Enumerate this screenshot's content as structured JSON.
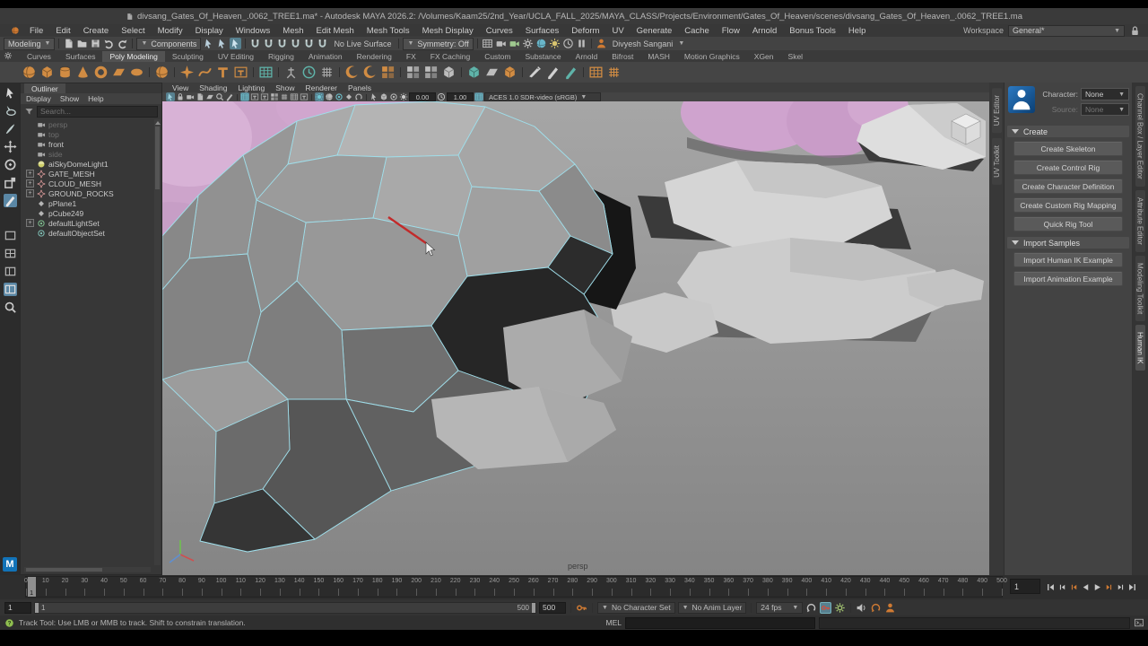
{
  "window": {
    "title": "divsang_Gates_Of_Heaven_.0062_TREE1.ma* - Autodesk MAYA 2026.2: /Volumes/Kaam25/2nd_Year/UCLA_FALL_2025/MAYA_CLASS/Projects/Environment/Gates_Of_Heaven/scenes/divsang_Gates_Of_Heaven_.0062_TREE1.ma"
  },
  "menu_bar": {
    "items": [
      "File",
      "Edit",
      "Create",
      "Select",
      "Modify",
      "Display",
      "Windows",
      "Mesh",
      "Edit Mesh",
      "Mesh Tools",
      "Mesh Display",
      "Curves",
      "Surfaces",
      "Deform",
      "UV",
      "Generate",
      "Cache",
      "Flow",
      "Arnold",
      "Bonus Tools",
      "Help"
    ],
    "workspace_label": "Workspace",
    "workspace_value": "General*"
  },
  "status_line": {
    "mode": "Modeling",
    "selection_label": "Components",
    "live_surface": "No Live Surface",
    "symmetry": "Symmetry: Off",
    "user": "Divyesh Sangani",
    "file_icons": [
      {
        "name": "new-scene-icon",
        "glyph": "doc",
        "color": "#c9c9c9"
      },
      {
        "name": "open-scene-icon",
        "glyph": "folder",
        "color": "#c9c9c9"
      },
      {
        "name": "save-scene-icon",
        "glyph": "save",
        "color": "#c9c9c9"
      },
      {
        "name": "undo-icon",
        "glyph": "undo",
        "color": "#c9c9c9"
      },
      {
        "name": "redo-icon",
        "glyph": "redo",
        "color": "#c9c9c9"
      }
    ],
    "mask_icons": [
      {
        "name": "select-hierarchy-icon",
        "glyph": "cursor",
        "color": "#b9cfdb"
      },
      {
        "name": "select-object-icon",
        "glyph": "cursor",
        "color": "#b9cfdb"
      },
      {
        "name": "select-component-icon",
        "glyph": "cursor",
        "color": "#cfe4ee",
        "active": true
      }
    ],
    "snap_icons": [
      {
        "name": "snap-grid-icon",
        "glyph": "magnet",
        "color": "#b7c9c9"
      },
      {
        "name": "snap-curve-icon",
        "glyph": "magnet",
        "color": "#b7c9c9"
      },
      {
        "name": "snap-point-icon",
        "glyph": "magnet",
        "color": "#b7c9c9"
      },
      {
        "name": "snap-projected-center-icon",
        "glyph": "magnet",
        "color": "#b7c9c9"
      },
      {
        "name": "snap-view-plane-icon",
        "glyph": "magnet",
        "color": "#b7c9c9"
      },
      {
        "name": "make-live-icon",
        "glyph": "magnet",
        "color": "#b7c9c9"
      }
    ],
    "render_icons": [
      {
        "name": "render-view-icon",
        "glyph": "grid",
        "color": "#bdbdbd"
      },
      {
        "name": "render-frame-icon",
        "glyph": "camera",
        "color": "#bdbdbd"
      },
      {
        "name": "ipr-render-icon",
        "glyph": "camera",
        "color": "#9fc98f"
      },
      {
        "name": "render-settings-icon",
        "glyph": "gear",
        "color": "#bdbdbd"
      },
      {
        "name": "hypershade-icon",
        "glyph": "sphere",
        "color": "#69b5c9"
      },
      {
        "name": "light-editor-icon",
        "glyph": "light",
        "color": "#d8c46f"
      },
      {
        "name": "render-setup-icon",
        "glyph": "clock",
        "color": "#bdbdbd"
      },
      {
        "name": "pause-viewport-icon",
        "glyph": "pause",
        "color": "#bdbdbd"
      }
    ]
  },
  "shelf": {
    "tabs": [
      "Curves",
      "Surfaces",
      "Poly Modeling",
      "Sculpting",
      "UV Editing",
      "Rigging",
      "Animation",
      "Rendering",
      "FX",
      "FX Caching",
      "Custom",
      "Substance",
      "Arnold",
      "Bifrost",
      "MASH",
      "Motion Graphics",
      "XGen",
      "Skel"
    ],
    "active_tab": "Poly Modeling",
    "icons": [
      {
        "name": "poly-sphere-icon",
        "glyph": "sphere",
        "color": "#d18c43"
      },
      {
        "name": "poly-cube-icon",
        "glyph": "cube",
        "color": "#d18c43"
      },
      {
        "name": "poly-cylinder-icon",
        "glyph": "cylinder",
        "color": "#d18c43"
      },
      {
        "name": "poly-cone-icon",
        "glyph": "cone",
        "color": "#d18c43"
      },
      {
        "name": "poly-torus-icon",
        "glyph": "torus",
        "color": "#d18c43"
      },
      {
        "name": "poly-plane-icon",
        "glyph": "plane",
        "color": "#d18c43"
      },
      {
        "name": "poly-disc-icon",
        "glyph": "disc",
        "color": "#d18c43"
      },
      {
        "sep": true
      },
      {
        "name": "platonic-solid-icon",
        "glyph": "sphere",
        "color": "#d18c43"
      },
      {
        "sep": true
      },
      {
        "name": "sweep-mesh-icon",
        "glyph": "star",
        "color": "#d18c43"
      },
      {
        "name": "curve-warp-icon",
        "glyph": "curve",
        "color": "#d18c43"
      },
      {
        "name": "poly-text-icon",
        "glyph": "text",
        "color": "#d18c43"
      },
      {
        "name": "type-tool-icon",
        "glyph": "type",
        "color": "#d18c43"
      },
      {
        "sep": true
      },
      {
        "name": "booleans-icon",
        "glyph": "grid",
        "color": "#5fb3a9"
      },
      {
        "sep": true
      },
      {
        "name": "construction-aim-icon",
        "glyph": "tripod",
        "color": "#a8a8a8"
      },
      {
        "name": "history-toggle-icon",
        "glyph": "clock",
        "color": "#5fb3a9"
      },
      {
        "name": "lattice-icon",
        "glyph": "lattice",
        "color": "#a8a8a8"
      },
      {
        "sep": true
      },
      {
        "name": "smooth-icon",
        "glyph": "crescent",
        "color": "#d18c43"
      },
      {
        "name": "subdiv-proxy-icon",
        "glyph": "crescent",
        "color": "#d18c43"
      },
      {
        "name": "mirror-icon",
        "glyph": "squares",
        "color": "#d18c43"
      },
      {
        "sep": true
      },
      {
        "name": "combine-icon",
        "glyph": "squares",
        "color": "#bdbdbd"
      },
      {
        "name": "separate-icon",
        "glyph": "squares",
        "color": "#bdbdbd"
      },
      {
        "name": "extract-icon",
        "glyph": "cube",
        "color": "#bdbdbd"
      },
      {
        "sep": true
      },
      {
        "name": "bevel-icon",
        "glyph": "cube",
        "color": "#5fb3a9"
      },
      {
        "name": "bridge-icon",
        "glyph": "plane",
        "color": "#bdbdbd"
      },
      {
        "name": "extrude-icon",
        "glyph": "cube",
        "color": "#d18c43"
      },
      {
        "sep": true
      },
      {
        "name": "multi-cut-icon",
        "glyph": "knife",
        "color": "#d0d0d0"
      },
      {
        "name": "connect-icon",
        "glyph": "pen",
        "color": "#d0d0d0"
      },
      {
        "name": "quad-draw-icon",
        "glyph": "pen",
        "color": "#5fb3a9"
      },
      {
        "sep": true
      },
      {
        "name": "smooth-mesh-preview-icon",
        "glyph": "grid",
        "color": "#d18c43"
      },
      {
        "name": "sculpt-tool-icon",
        "glyph": "lattice",
        "color": "#d18c43"
      }
    ]
  },
  "toolbox": {
    "tools": [
      {
        "name": "select-tool",
        "glyph": "cursor",
        "color": "#d8d8d8"
      },
      {
        "name": "lasso-select-tool",
        "glyph": "lasso",
        "color": "#bfcfcf"
      },
      {
        "name": "paint-select-tool",
        "glyph": "brush",
        "color": "#bfcfcf"
      },
      {
        "name": "move-tool",
        "glyph": "move",
        "color": "#c9c9c9"
      },
      {
        "name": "rotate-tool",
        "glyph": "rotate",
        "color": "#c9c9c9"
      },
      {
        "name": "scale-tool",
        "glyph": "scale",
        "color": "#c9c9c9"
      },
      {
        "name": "last-tool-multi-cut",
        "glyph": "pen",
        "color": "#e8e8e8",
        "active": true
      }
    ],
    "layouts": [
      {
        "name": "layout-single-pane",
        "glyph": "layout1",
        "color": "#b5b5b5"
      },
      {
        "name": "layout-four-pane",
        "glyph": "layout4",
        "color": "#b5b5b5"
      },
      {
        "name": "layout-two-pane",
        "glyph": "layout2",
        "color": "#b5b5b5"
      },
      {
        "name": "layout-persp-outliner",
        "glyph": "layout2",
        "color": "#e0e0e0",
        "active": true
      }
    ],
    "zoom_tool": {
      "name": "zoom-tool",
      "glyph": "magnifier",
      "color": "#c9c9c9"
    }
  },
  "outliner": {
    "tab": "Outliner",
    "menus": [
      "Display",
      "Show",
      "Help"
    ],
    "search_placeholder": "Search...",
    "items": [
      {
        "label": "persp",
        "icon": "camera",
        "dim": true
      },
      {
        "label": "top",
        "icon": "camera",
        "dim": true
      },
      {
        "label": "front",
        "icon": "camera"
      },
      {
        "label": "side",
        "icon": "camera",
        "dim": true
      },
      {
        "label": "aiSkyDomeLight1",
        "icon": "skydome",
        "icon_color": "#cfd06b"
      },
      {
        "label": "GATE_MESH",
        "icon": "transform",
        "icon_color": "#c98f8f",
        "expandable": true
      },
      {
        "label": "CLOUD_MESH",
        "icon": "transform",
        "icon_color": "#c98f8f",
        "expandable": true
      },
      {
        "label": "GROUND_ROCKS",
        "icon": "transform",
        "icon_color": "#c98f8f",
        "expandable": true
      },
      {
        "label": "pPlane1",
        "icon": "diamond",
        "icon_color": "#b5b5b5"
      },
      {
        "label": "pCube249",
        "icon": "diamond",
        "icon_color": "#b5b5b5"
      },
      {
        "label": "defaultLightSet",
        "icon": "set",
        "icon_color": "#7fbf8f",
        "expandable": true
      },
      {
        "label": "defaultObjectSet",
        "icon": "set",
        "icon_color": "#7fbfb5"
      }
    ]
  },
  "viewport": {
    "menus": [
      "View",
      "Shading",
      "Lighting",
      "Show",
      "Renderer",
      "Panels"
    ],
    "exposure": "0.00",
    "gamma": "1.00",
    "color_space": "ACES 1.0 SDR-video (sRGB)",
    "camera_label": "persp",
    "toolbar_icons": [
      {
        "name": "select-camera-icon",
        "glyph": "cursor",
        "color": "#9fd3df",
        "active": true
      },
      {
        "name": "lock-camera-icon",
        "glyph": "lock",
        "color": "#b9b9b9"
      },
      {
        "name": "camera-attributes-icon",
        "glyph": "camera",
        "color": "#b9b9b9"
      },
      {
        "name": "bookmark-icon",
        "glyph": "doc",
        "color": "#b9b9b9"
      },
      {
        "name": "image-plane-icon",
        "glyph": "plane",
        "color": "#b9b9b9"
      },
      {
        "name": "two-d-pan-zoom-icon",
        "glyph": "magnifier",
        "color": "#b9b9b9"
      },
      {
        "name": "grease-pencil-icon",
        "glyph": "pen",
        "color": "#b9b9b9"
      },
      {
        "sep": true
      },
      {
        "name": "grid-toggle-icon",
        "glyph": "grid",
        "color": "#6fc3cf",
        "active": true
      },
      {
        "name": "film-gate-icon",
        "glyph": "type",
        "color": "#b9b9b9"
      },
      {
        "name": "resolution-gate-icon",
        "glyph": "type",
        "color": "#b9b9b9"
      },
      {
        "name": "gate-mask-icon",
        "glyph": "squares",
        "color": "#b9b9b9"
      },
      {
        "name": "field-chart-icon",
        "glyph": "lattice",
        "color": "#b9b9b9"
      },
      {
        "name": "safe-action-icon",
        "glyph": "grid",
        "color": "#b9b9b9"
      },
      {
        "name": "safe-title-icon",
        "glyph": "type",
        "color": "#b9b9b9"
      },
      {
        "sep": true
      },
      {
        "name": "lighting-icon",
        "glyph": "light",
        "color": "#6fc3cf",
        "active": true
      },
      {
        "name": "shadows-icon",
        "glyph": "sphere",
        "color": "#b9b9b9"
      },
      {
        "name": "ao-icon",
        "glyph": "set",
        "color": "#6fc3cf"
      },
      {
        "name": "anti-aliasing-icon",
        "glyph": "diamond",
        "color": "#b9b9b9"
      },
      {
        "name": "motion-blur-icon",
        "glyph": "loop",
        "color": "#b9b9b9"
      },
      {
        "sep": true
      },
      {
        "name": "isolate-select-icon",
        "glyph": "cursor",
        "color": "#b9b9b9"
      },
      {
        "name": "xray-icon",
        "glyph": "cube",
        "color": "#b9b9b9"
      },
      {
        "name": "wireframe-on-shaded-icon",
        "glyph": "set",
        "color": "#b9b9b9"
      }
    ]
  },
  "side_tabs_inner": [
    {
      "label": "UV Editor"
    },
    {
      "label": "UV Toolkit"
    }
  ],
  "side_tabs_outer": [
    {
      "label": "Channel Box / Layer Editor"
    },
    {
      "label": "Attribute Editor"
    },
    {
      "label": "Modeling Toolkit"
    },
    {
      "label": "Human IK",
      "active": true
    }
  ],
  "humanik": {
    "character_label": "Character:",
    "character_value": "None",
    "source_label": "Source:",
    "source_value": "None",
    "sections": [
      {
        "title": "Create",
        "buttons": [
          "Create Skeleton",
          "Create Control Rig",
          "Create Character Definition",
          "Create Custom Rig Mapping",
          "Quick Rig Tool"
        ]
      },
      {
        "title": "Import Samples",
        "buttons": [
          "Import Human IK Example",
          "Import Animation Example"
        ]
      }
    ]
  },
  "timeline": {
    "start": 0,
    "end": 500,
    "label_step": 10,
    "current_frame": "1",
    "frame_field": "1",
    "transport": [
      {
        "name": "go-to-start-button",
        "glyph": "skipstart",
        "color": "#c8c8c8"
      },
      {
        "name": "step-back-frame-button",
        "glyph": "stepback",
        "color": "#c8c8c8"
      },
      {
        "name": "step-back-key-button",
        "glyph": "stepback",
        "color": "#cf7a33"
      },
      {
        "name": "play-backwards-button",
        "glyph": "playback",
        "color": "#c8c8c8"
      },
      {
        "name": "play-forwards-button",
        "glyph": "play",
        "color": "#c8c8c8"
      },
      {
        "name": "step-forward-key-button",
        "glyph": "stepfwd",
        "color": "#cf7a33"
      },
      {
        "name": "step-forward-frame-button",
        "glyph": "stepfwd",
        "color": "#c8c8c8"
      },
      {
        "name": "go-to-end-button",
        "glyph": "skipend",
        "color": "#c8c8c8"
      }
    ]
  },
  "range_slider": {
    "anim_start": "1",
    "range_start": "1",
    "range_end": "500",
    "anim_end": "500",
    "character_set": "No Character Set",
    "anim_layer": "No Anim Layer",
    "fps": "24 fps",
    "key_icon_color": "#cf7a33",
    "icons": [
      {
        "name": "playback-loop-icon",
        "glyph": "loop",
        "color": "#c0c0c0"
      },
      {
        "name": "auto-keyframe-icon",
        "glyph": "key",
        "color": "#cf4f3f",
        "active": true
      },
      {
        "name": "animation-preferences-icon",
        "glyph": "gear",
        "color": "#9fbf6f"
      },
      {
        "sep": true
      },
      {
        "name": "mute-audio-icon",
        "glyph": "speaker",
        "color": "#c0c0c0"
      },
      {
        "name": "sync-playback-icon",
        "glyph": "loop",
        "color": "#cf7a33"
      },
      {
        "name": "character-menu-icon",
        "glyph": "person",
        "color": "#cf7a33"
      }
    ]
  },
  "command_line": {
    "label": "MEL"
  },
  "help_line": {
    "text": "Track Tool: Use LMB or MMB to track. Shift to constrain translation."
  },
  "colors": {
    "accent_orange": "#d18c43",
    "accent_teal": "#4fa7b3",
    "wire_cyan": "#9fdde9",
    "selection_red": "#c22a2a",
    "cloud_pink": "#cda4cb",
    "viewport_bg_top": "#a6a6a6",
    "viewport_bg_bottom": "#858585"
  }
}
